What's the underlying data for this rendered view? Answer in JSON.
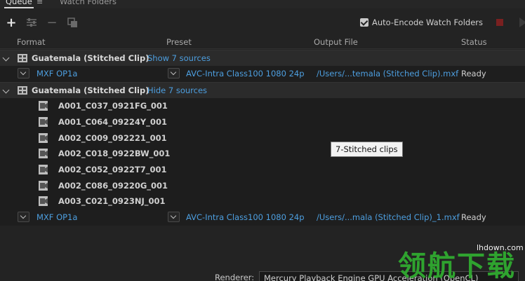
{
  "tabs": {
    "queue": "Queue",
    "watch_folders": "Watch Folders"
  },
  "toolbar": {
    "auto_encode_label": "Auto-Encode Watch Folders",
    "auto_encode_checked": true
  },
  "columns": {
    "format": "Format",
    "preset": "Preset",
    "output_file": "Output File",
    "status": "Status"
  },
  "groups": [
    {
      "name": "Guatemala (Stitched Clip)",
      "toggle_label": "Show 7 sources",
      "item": {
        "format": "MXF OP1a",
        "preset": "AVC-Intra Class100 1080 24p",
        "output_file": "/Users/...temala (Stitched Clip).mxf",
        "status": "Ready"
      }
    },
    {
      "name": "Guatemala (Stitched Clip)",
      "toggle_label": "Hide 7 sources",
      "clips": [
        "A001_C037_0921FG_001",
        "A001_C064_09224Y_001",
        "A002_C009_092221_001",
        "A002_C018_0922BW_001",
        "A002_C052_0922T7_001",
        "A002_C086_09220G_001",
        "A003_C021_0923NJ_001"
      ],
      "item": {
        "format": "MXF OP1a",
        "preset": "AVC-Intra Class100 1080 24p",
        "output_file": "/Users/...mala (Stitched Clip)_1.mxf",
        "status": "Ready"
      }
    }
  ],
  "tooltip": "7-Stitched clips",
  "renderer": {
    "label": "Renderer:",
    "value": "Mercury Playback Engine GPU Acceleration (OpenCL)"
  },
  "watermark": {
    "url": "lhdown.com",
    "text": "领航下载"
  },
  "colors": {
    "link": "#4d9fe0",
    "background": "#232323",
    "watermark": "#2fa32f"
  }
}
